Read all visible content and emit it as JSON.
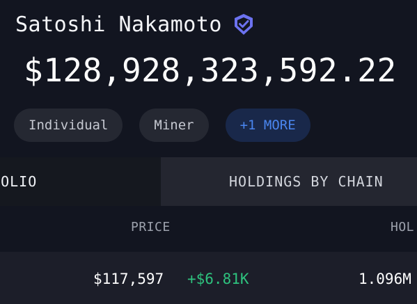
{
  "profile": {
    "name": "Satoshi Nakamoto",
    "verified_icon": "verified-badge-icon",
    "balance": "$128,928,323,592.22",
    "tags": [
      "Individual",
      "Miner"
    ],
    "more_tag": "+1 MORE"
  },
  "tabs": {
    "portfolio_label": "PORTFOLIO",
    "portfolio_visible": "TFOLIO",
    "holdings_label": "HOLDINGS BY CHAIN"
  },
  "table": {
    "headers": {
      "price": "PRICE",
      "holdings": "HOL"
    },
    "rows": [
      {
        "price": "$117,597",
        "change": "+$6.81K",
        "holdings": "1.096M"
      }
    ]
  },
  "colors": {
    "background": "#121520",
    "accent_blue": "#4a86f0",
    "verified_purple": "#6c72f0",
    "positive_green": "#2ec27e"
  }
}
